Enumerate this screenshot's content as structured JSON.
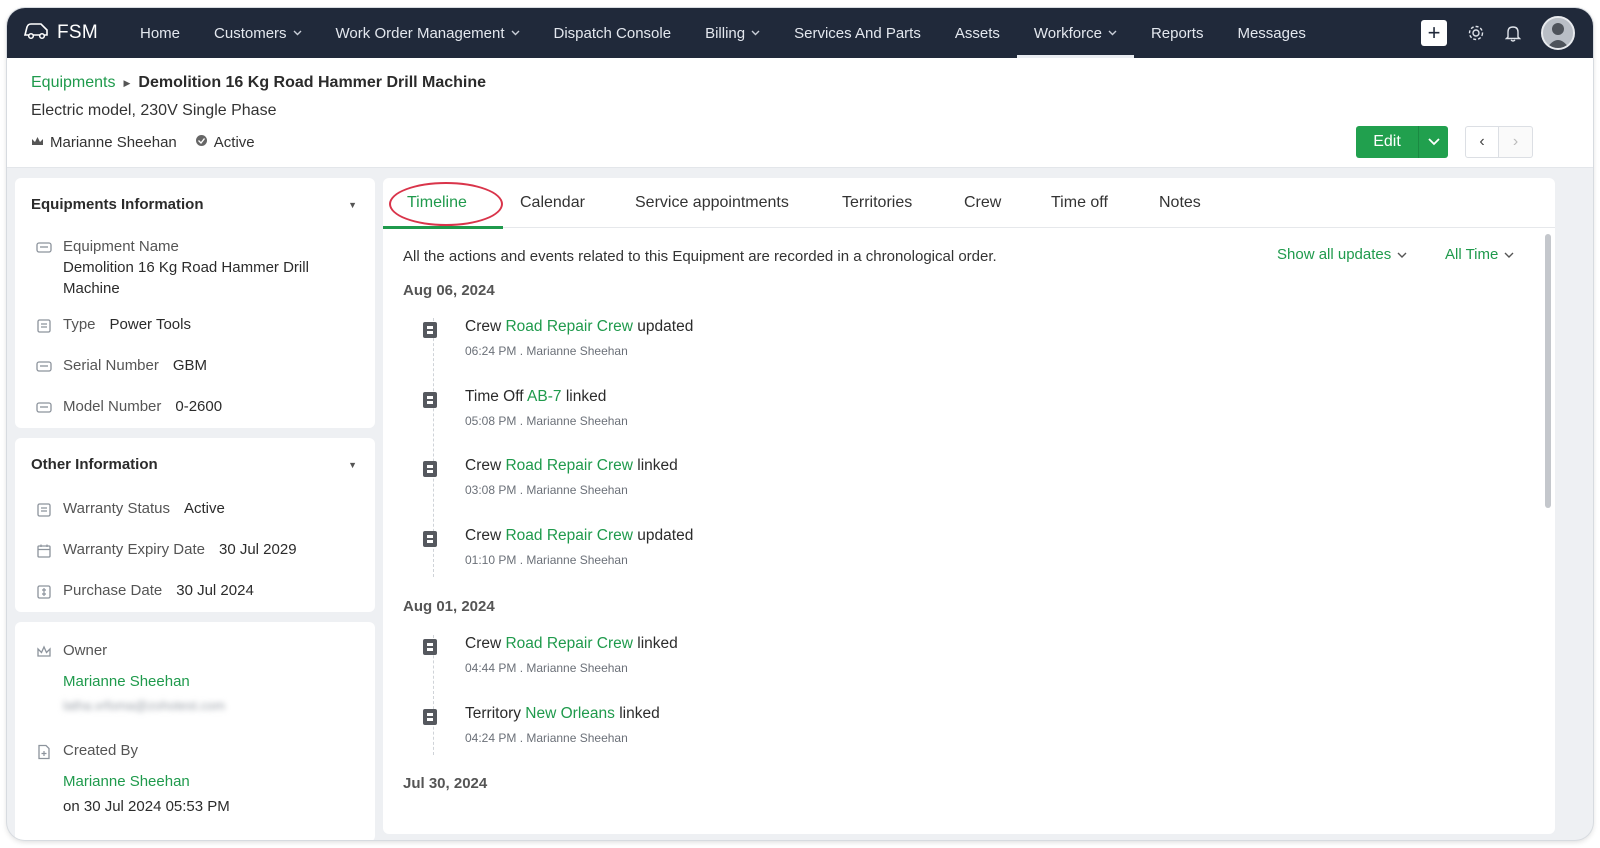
{
  "nav": {
    "brand": "FSM",
    "items": [
      {
        "label": "Home",
        "caret": false
      },
      {
        "label": "Customers",
        "caret": true
      },
      {
        "label": "Work Order Management",
        "caret": true
      },
      {
        "label": "Dispatch Console",
        "caret": false
      },
      {
        "label": "Billing",
        "caret": true
      },
      {
        "label": "Services And Parts",
        "caret": false
      },
      {
        "label": "Assets",
        "caret": false
      },
      {
        "label": "Workforce",
        "caret": true
      },
      {
        "label": "Reports",
        "caret": false
      },
      {
        "label": "Messages",
        "caret": false
      }
    ],
    "active": "Workforce",
    "icons": [
      "plus-icon",
      "gear-icon",
      "bell-icon",
      "avatar"
    ]
  },
  "header": {
    "breadcrumb_link": "Equipments",
    "title": "Demolition 16 Kg Road Hammer Drill Machine",
    "subtitle": "Electric model, 230V Single Phase",
    "owner": "Marianne Sheehan",
    "status": "Active",
    "edit_label": "Edit"
  },
  "equipments_info": {
    "title": "Equipments Information",
    "name_label": "Equipment Name",
    "name_value_line1": "Demolition 16 Kg Road Hammer Drill",
    "name_value_line2": "Machine",
    "type_label": "Type",
    "type_value": "Power Tools",
    "serial_label": "Serial Number",
    "serial_value": "GBM",
    "model_label": "Model Number",
    "model_value": "0-2600"
  },
  "other_info": {
    "title": "Other Information",
    "warranty_status_label": "Warranty Status",
    "warranty_status_value": "Active",
    "warranty_expiry_label": "Warranty Expiry Date",
    "warranty_expiry_value": "30 Jul 2029",
    "purchase_label": "Purchase Date",
    "purchase_value": "30 Jul 2024"
  },
  "ownership": {
    "owner_label": "Owner",
    "owner_name": "Marianne Sheehan",
    "owner_email": "latha.vrfoma@zohotest.com",
    "created_label": "Created By",
    "created_name": "Marianne Sheehan",
    "created_on": "on 30 Jul 2024 05:53 PM"
  },
  "tabs": [
    "Timeline",
    "Calendar",
    "Service appointments",
    "Territories",
    "Crew",
    "Time off",
    "Notes"
  ],
  "active_tab": "Timeline",
  "timeline": {
    "intro": "All the actions and events related to this Equipment are recorded in a chronological order.",
    "filter_updates": "Show all updates",
    "filter_time": "All Time",
    "groups": [
      {
        "date": "Aug 06, 2024",
        "events": [
          {
            "prefix": "Crew",
            "link": "Road Repair Crew",
            "action": "updated",
            "meta": "06:24 PM . Marianne Sheehan"
          },
          {
            "prefix": "Time Off",
            "link": "AB-7",
            "action": "linked",
            "meta": "05:08 PM . Marianne Sheehan"
          },
          {
            "prefix": "Crew",
            "link": "Road Repair Crew",
            "action": "linked",
            "meta": "03:08 PM . Marianne Sheehan"
          },
          {
            "prefix": "Crew",
            "link": "Road Repair Crew",
            "action": "updated",
            "meta": "01:10 PM . Marianne Sheehan"
          }
        ]
      },
      {
        "date": "Aug 01, 2024",
        "events": [
          {
            "prefix": "Crew",
            "link": "Road Repair Crew",
            "action": "linked",
            "meta": "04:44 PM . Marianne Sheehan"
          },
          {
            "prefix": "Territory",
            "link": "New Orleans",
            "action": "linked",
            "meta": "04:24 PM . Marianne Sheehan"
          }
        ]
      },
      {
        "date": "Jul 30, 2024",
        "events": []
      }
    ]
  },
  "colors": {
    "nav_bg": "#20293a",
    "accent_green": "#1f9a4c",
    "button_green": "#21a04e",
    "highlight_ring": "#d9344a"
  }
}
